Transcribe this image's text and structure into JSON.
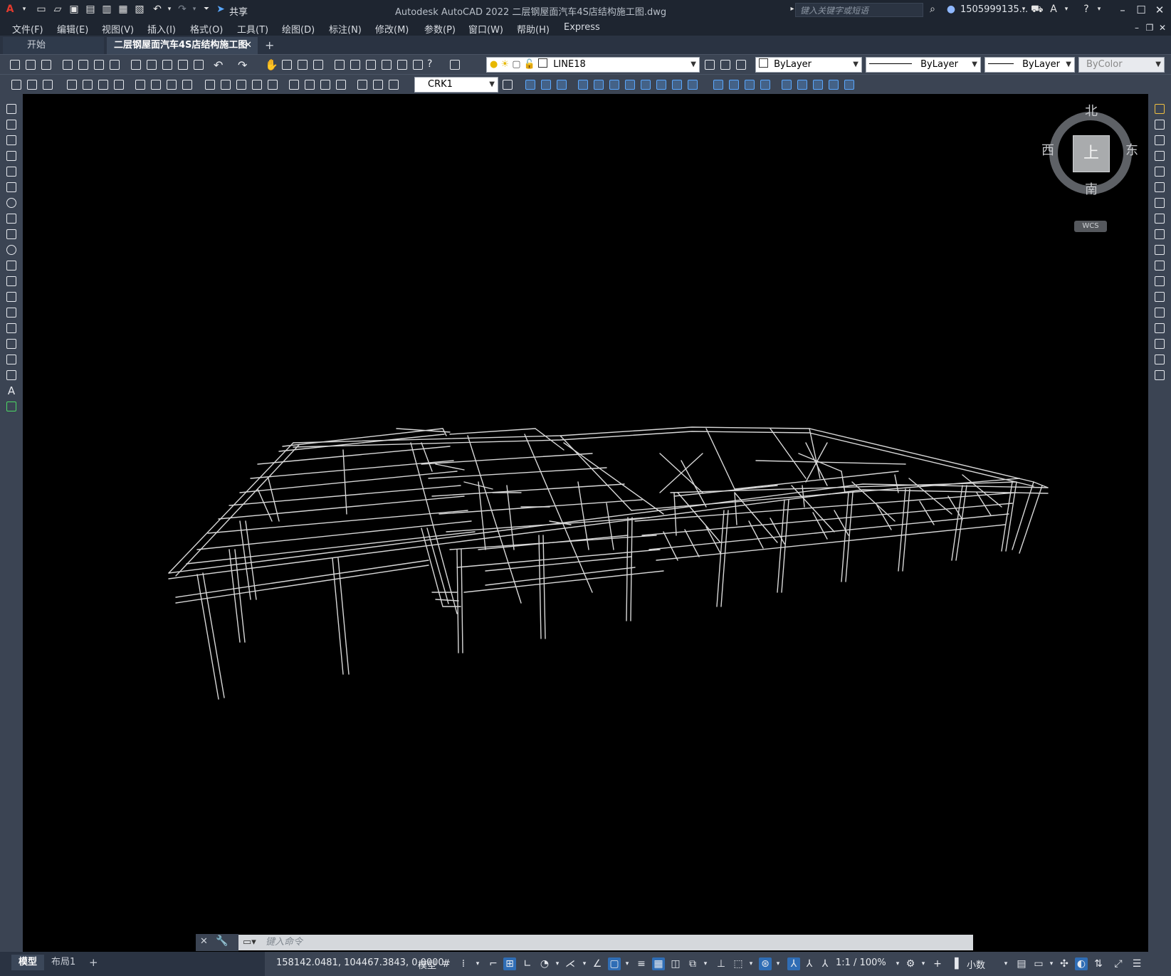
{
  "app": {
    "title": "Autodesk AutoCAD 2022    二层钢屋面汽车4S店结构施工图.dwg",
    "search_placeholder": "键入关键字或短语",
    "user": "1505999135...",
    "share_label": "共享"
  },
  "menu": [
    "文件(F)",
    "编辑(E)",
    "视图(V)",
    "插入(I)",
    "格式(O)",
    "工具(T)",
    "绘图(D)",
    "标注(N)",
    "修改(M)",
    "参数(P)",
    "窗口(W)",
    "帮助(H)",
    "Express"
  ],
  "tabs": {
    "start": "开始",
    "drawing": "二层钢屋面汽车4S店结构施工图*",
    "close": "✕",
    "add": "+"
  },
  "toolbar": {
    "layer": "LINE18",
    "color": "ByLayer",
    "linetype": "ByLayer",
    "lineweight": "ByLayer",
    "plotstyle": "ByColor",
    "dimstyle": "CRK1"
  },
  "viewcube": {
    "north": "北",
    "south": "南",
    "east": "东",
    "west": "西",
    "face": "上",
    "wcs": "WCS"
  },
  "command": {
    "placeholder": "键入命令"
  },
  "layout_tabs": [
    "模型",
    "布局1",
    "+"
  ],
  "status": {
    "coords": "158142.0481, 104467.3843, 0.0000",
    "model": "模型",
    "scale": "1:1 / 100%",
    "units": "小数"
  },
  "colors": {
    "titlebar": "#1e2530",
    "toolbar": "#3b4453",
    "viewport": "#000000",
    "wireframe": "#d8d8d8",
    "accent": "#2f6db5"
  }
}
